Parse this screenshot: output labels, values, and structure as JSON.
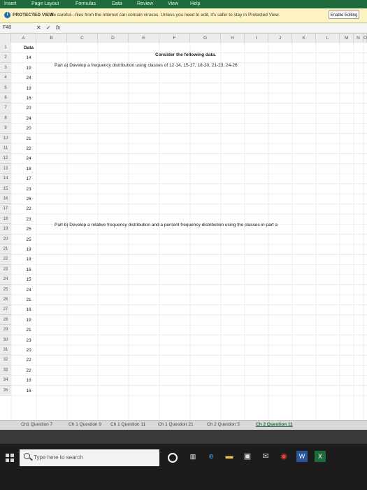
{
  "ribbon": {
    "tabs": [
      "Insert",
      "Page Layout",
      "Formulas",
      "Data",
      "Review",
      "View",
      "Help"
    ]
  },
  "protected_view": {
    "icon": "info-icon",
    "label": "PROTECTED VIEW",
    "message": "Be careful—files from the Internet can contain viruses. Unless you need to edit, it's safer to stay in Protected View.",
    "enable_button": "Enable Editing"
  },
  "formula_bar": {
    "name_box": "F48",
    "cancel_icon": "✕",
    "enter_icon": "✓",
    "fx_label": "fx",
    "value": ""
  },
  "columns": [
    "A",
    "B",
    "C",
    "D",
    "E",
    "F",
    "G",
    "H",
    "I",
    "J",
    "K",
    "L",
    "M",
    "N",
    "O"
  ],
  "rows": [
    {
      "num": "1",
      "value": "Data"
    },
    {
      "num": "2",
      "value": "14"
    },
    {
      "num": "3",
      "value": "19"
    },
    {
      "num": "4",
      "value": "24"
    },
    {
      "num": "5",
      "value": "19"
    },
    {
      "num": "6",
      "value": "16"
    },
    {
      "num": "7",
      "value": "20"
    },
    {
      "num": "8",
      "value": "24"
    },
    {
      "num": "9",
      "value": "20"
    },
    {
      "num": "10",
      "value": "21"
    },
    {
      "num": "11",
      "value": "22"
    },
    {
      "num": "12",
      "value": "24"
    },
    {
      "num": "13",
      "value": "18"
    },
    {
      "num": "14",
      "value": "17"
    },
    {
      "num": "15",
      "value": "23"
    },
    {
      "num": "16",
      "value": "26"
    },
    {
      "num": "17",
      "value": "22"
    },
    {
      "num": "18",
      "value": "23"
    },
    {
      "num": "19",
      "value": "25"
    },
    {
      "num": "20",
      "value": "25"
    },
    {
      "num": "21",
      "value": "19"
    },
    {
      "num": "22",
      "value": "18"
    },
    {
      "num": "23",
      "value": "16"
    },
    {
      "num": "24",
      "value": "15"
    },
    {
      "num": "25",
      "value": "24"
    },
    {
      "num": "26",
      "value": "21"
    },
    {
      "num": "27",
      "value": "16"
    },
    {
      "num": "28",
      "value": "19"
    },
    {
      "num": "29",
      "value": "21"
    },
    {
      "num": "30",
      "value": "23"
    },
    {
      "num": "31",
      "value": "20"
    },
    {
      "num": "32",
      "value": "22"
    },
    {
      "num": "33",
      "value": "22"
    },
    {
      "num": "34",
      "value": "16"
    },
    {
      "num": "35",
      "value": "16"
    }
  ],
  "content": {
    "heading": "Consider the following data.",
    "part_a": "Part a) Develop a frequency distribution using classes of 12-14, 15-17, 18-20, 21-23, 24-26",
    "part_b": "Part b) Develop a relative frequency distribution and a percent frequency distribution using the classes in part a"
  },
  "sheet_tabs": [
    {
      "label": "Ch1 Question 7",
      "active": false
    },
    {
      "label": "Ch 1 Question 9",
      "active": false
    },
    {
      "label": "Ch 1 Question 11",
      "active": false
    },
    {
      "label": "Ch 1 Question 21",
      "active": false
    },
    {
      "label": "Ch 2 Question 5",
      "active": false
    },
    {
      "label": "Ch 2 Question 11",
      "active": true
    }
  ],
  "taskbar": {
    "search_placeholder": "Type here to search",
    "icons": [
      "cortana-icon",
      "task-view-icon",
      "edge-icon",
      "file-explorer-icon",
      "store-icon",
      "mail-icon",
      "chrome-icon",
      "word-icon",
      "excel-icon"
    ]
  },
  "colors": {
    "ribbon": "#1e6b3b",
    "protected_bar": "#fdf3c4",
    "taskbar": "#1c1c1c"
  }
}
